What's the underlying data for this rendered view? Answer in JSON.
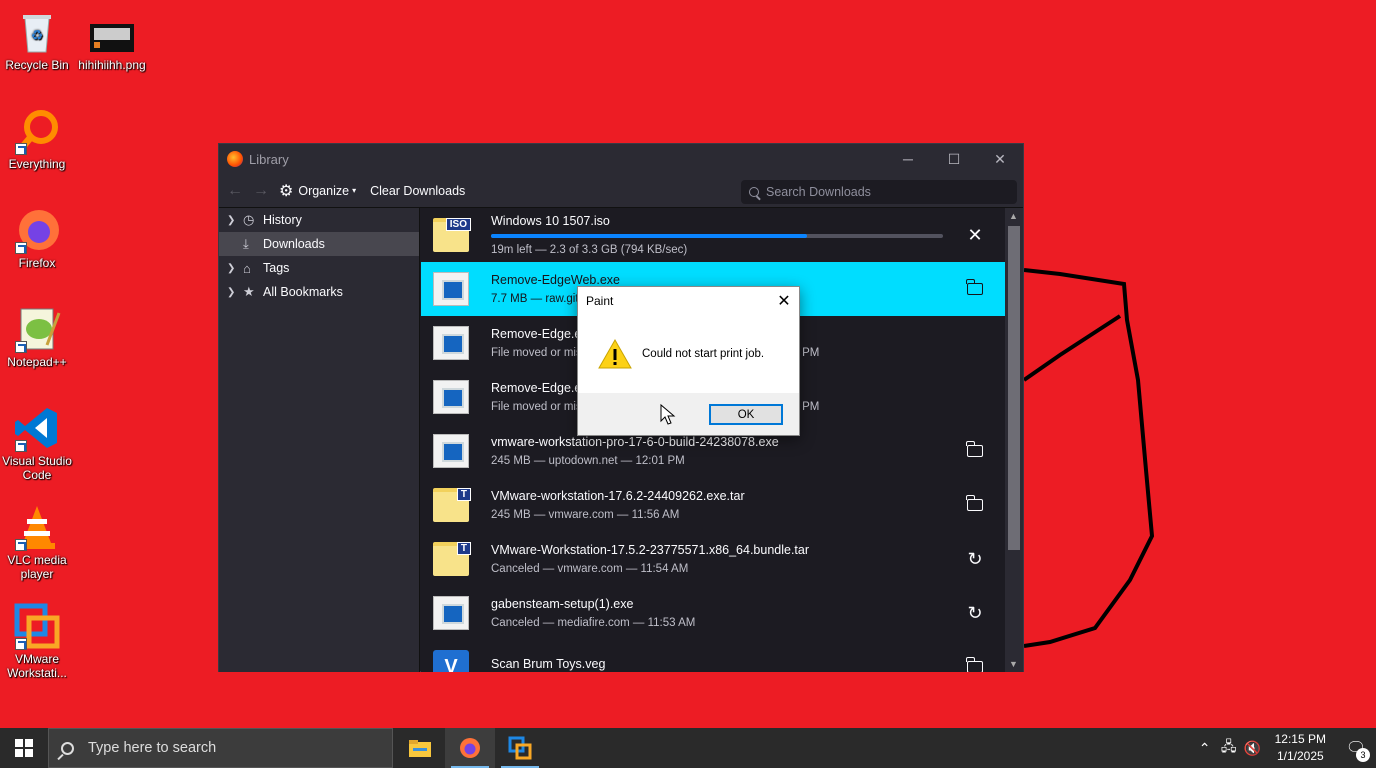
{
  "desktop": {
    "icons": [
      {
        "label": "Recycle Bin",
        "icon": "recycle-bin-icon"
      },
      {
        "label": "hihihiihh.png",
        "icon": "image-file-icon"
      },
      {
        "label": "Everything",
        "icon": "everything-icon"
      },
      {
        "label": "Firefox",
        "icon": "firefox-icon"
      },
      {
        "label": "Notepad++",
        "icon": "notepadpp-icon"
      },
      {
        "label": "Visual Studio Code",
        "icon": "vscode-icon"
      },
      {
        "label": "VLC media player",
        "icon": "vlc-icon"
      },
      {
        "label": "VMware Workstati...",
        "icon": "vmware-icon"
      }
    ]
  },
  "library": {
    "title": "Library",
    "toolbar": {
      "organize": "Organize",
      "clear": "Clear Downloads",
      "search_placeholder": "Search Downloads"
    },
    "sidebar": [
      {
        "label": "History",
        "icon": "clock-icon"
      },
      {
        "label": "Downloads",
        "icon": "download-icon"
      },
      {
        "label": "Tags",
        "icon": "tag-icon"
      },
      {
        "label": "All Bookmarks",
        "icon": "star-icon"
      }
    ],
    "downloads": [
      {
        "name": "Windows 10 1507.iso",
        "meta": "19m left — 2.3 of 3.3 GB (794 KB/sec)",
        "progress": 0.7,
        "tag": "ISO"
      },
      {
        "name": "Remove-EdgeWeb.exe",
        "meta": "7.7 MB — raw.githu"
      },
      {
        "name": "Remove-Edge.exe",
        "meta": "File moved or missi",
        "meta_tail": "PM"
      },
      {
        "name": "Remove-Edge.exe",
        "meta": "File moved or missi",
        "meta_tail": "PM"
      },
      {
        "name": "vmware-workstation-pro-17-6-0-build-24238078.exe",
        "meta": "245 MB — uptodown.net — 12:01 PM"
      },
      {
        "name": "VMware-workstation-17.6.2-24409262.exe.tar",
        "meta": "245 MB — vmware.com — 11:56 AM",
        "tag": "T"
      },
      {
        "name": "VMware-Workstation-17.5.2-23775571.x86_64.bundle.tar",
        "meta": "Canceled — vmware.com — 11:54 AM",
        "tag": "T"
      },
      {
        "name": "gabensteam-setup(1).exe",
        "meta": "Canceled — mediafire.com — 11:53 AM"
      },
      {
        "name": "Scan Brum Toys.veg",
        "meta": "",
        "tag": "V"
      }
    ]
  },
  "dialog": {
    "title": "Paint",
    "message": "Could not start print job.",
    "ok": "OK"
  },
  "taskbar": {
    "search_placeholder": "Type here to search",
    "time": "12:15 PM",
    "date": "1/1/2025",
    "notifications": "3"
  }
}
